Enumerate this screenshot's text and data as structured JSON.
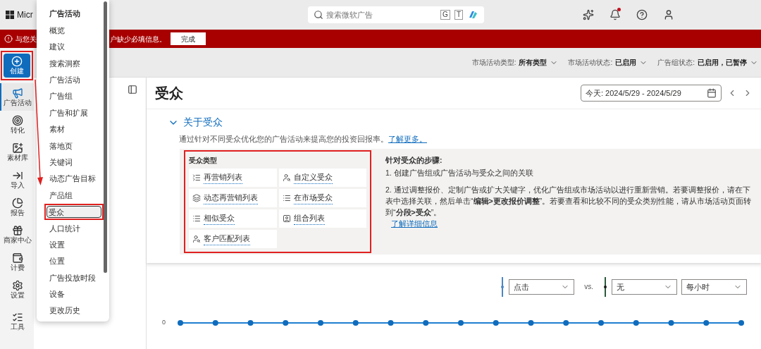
{
  "header": {
    "logo_text": "Micr",
    "search": {
      "placeholder": "搜索微软广告",
      "keys": [
        "G",
        "T"
      ]
    },
    "notification_dot": true
  },
  "banner": {
    "text_start": "与您关",
    "text_end": "户缺少必填信息。",
    "button": "完成"
  },
  "rail": {
    "create": "创建",
    "create_annotated": true,
    "items": [
      {
        "label": "广告活动",
        "selected": true
      },
      {
        "label": "转化",
        "selected": false
      },
      {
        "label": "素材库",
        "selected": false
      },
      {
        "label": "导入",
        "selected": false
      },
      {
        "label": "报告",
        "selected": false
      },
      {
        "label": "商家中心",
        "selected": false
      },
      {
        "label": "计费",
        "selected": false
      },
      {
        "label": "设置",
        "selected": false
      },
      {
        "label": "工具",
        "selected": false
      }
    ]
  },
  "menu": {
    "header": "广告活动",
    "items": [
      {
        "label": "概览",
        "selected": false
      },
      {
        "label": "建议",
        "selected": false
      },
      {
        "label": "搜索洞察",
        "selected": false
      },
      {
        "label": "广告活动",
        "selected": false
      },
      {
        "label": "广告组",
        "selected": false
      },
      {
        "label": "广告和扩展",
        "selected": false
      },
      {
        "label": "素材",
        "selected": false
      },
      {
        "label": "落地页",
        "selected": false
      },
      {
        "label": "关键词",
        "selected": false
      },
      {
        "label": "动态广告目标",
        "selected": false
      },
      {
        "label": "产品组",
        "selected": false
      },
      {
        "label": "受众",
        "selected": true
      },
      {
        "label": "人口统计",
        "selected": false
      },
      {
        "label": "设置",
        "selected": false
      },
      {
        "label": "位置",
        "selected": false
      },
      {
        "label": "广告投放时段",
        "selected": false
      },
      {
        "label": "设备",
        "selected": false
      },
      {
        "label": "更改历史",
        "selected": false
      }
    ]
  },
  "filters": [
    {
      "label": "市场活动类型:",
      "value": "所有类型"
    },
    {
      "label": "市场活动状态:",
      "value": "已启用"
    },
    {
      "label": "广告组状态:",
      "value": "已启用，已暂停"
    }
  ],
  "page": {
    "title": "受众",
    "date_range": "今天: 2024/5/29 - 2024/5/29"
  },
  "about": {
    "title": "关于受众",
    "expanded": true,
    "intro": "通过针对不同受众优化您的广告活动来提高您的投资回报率。",
    "intro_link": "了解更多。",
    "types_title": "受众类型",
    "types_annotated": true,
    "types": [
      "再营销列表",
      "自定义受众",
      "动态再营销列表",
      "在市场受众",
      "相似受众",
      "组合列表",
      "客户匹配列表"
    ],
    "steps_title": "针对受众的步骤:",
    "steps": [
      "1. 创建广告组或广告活动与受众之间的关联",
      "2. 通过调整报价、定制广告或扩大关键字，优化广告组或市场活动以进行重新营销。若要调整报价，请在下表中选择关联，然后单击“**编辑>更改报价调整**”。若要查看和比较不同的受众类别性能，请从市场活动页面转到“**分段>受众**”。"
    ],
    "steps_link": "了解详细信息"
  },
  "chart": {
    "metric_1": "点击",
    "vs": "vs.",
    "metric_2": "无",
    "interval": "每小时",
    "y_label": "0"
  }
}
